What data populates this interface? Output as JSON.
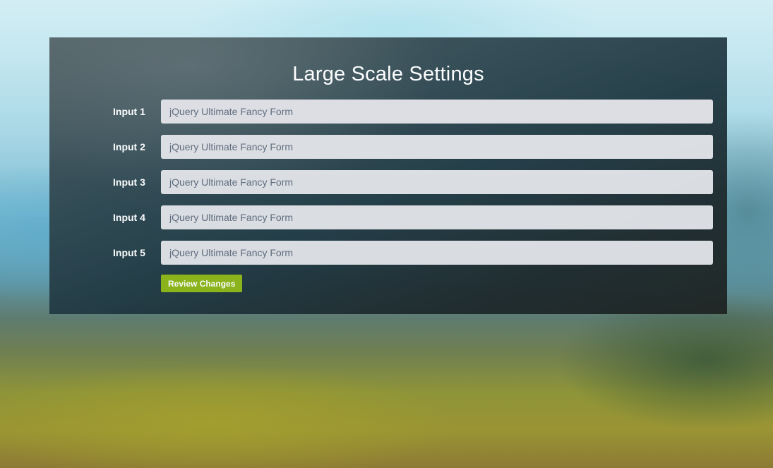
{
  "form": {
    "title": "Large Scale Settings",
    "fields": [
      {
        "label": "Input 1",
        "placeholder": "jQuery Ultimate Fancy Form",
        "value": ""
      },
      {
        "label": "Input 2",
        "placeholder": "jQuery Ultimate Fancy Form",
        "value": ""
      },
      {
        "label": "Input 3",
        "placeholder": "jQuery Ultimate Fancy Form",
        "value": ""
      },
      {
        "label": "Input 4",
        "placeholder": "jQuery Ultimate Fancy Form",
        "value": ""
      },
      {
        "label": "Input 5",
        "placeholder": "jQuery Ultimate Fancy Form",
        "value": ""
      }
    ],
    "submit_label": "Review Changes"
  },
  "colors": {
    "accent_button": "#8db516",
    "input_background": "#dedfe3",
    "panel_background": "#2a3c43"
  }
}
